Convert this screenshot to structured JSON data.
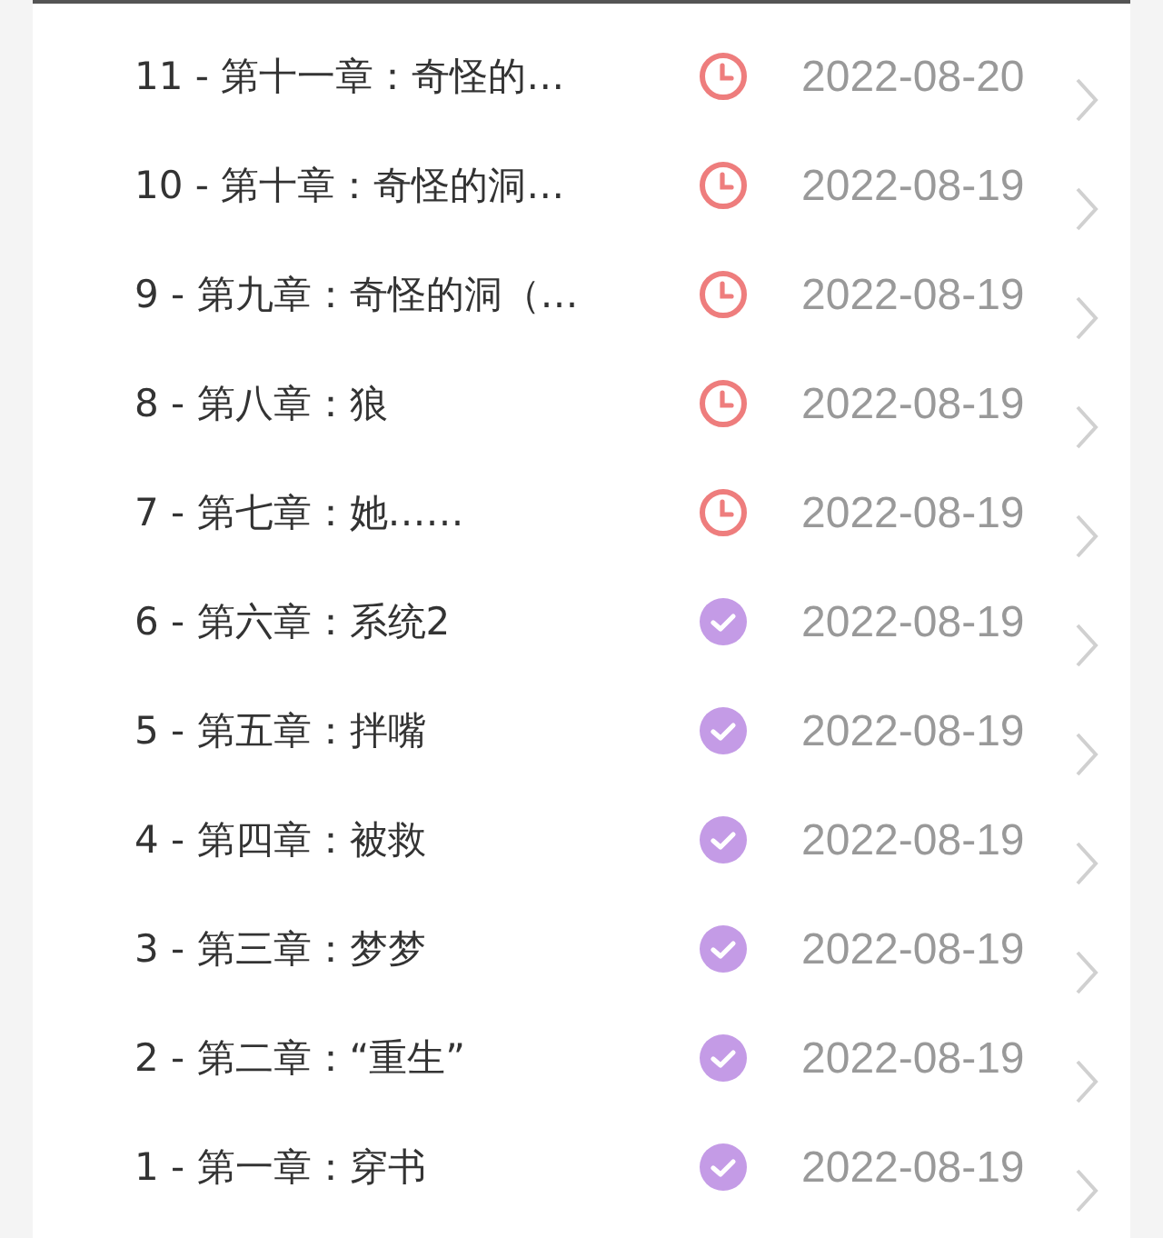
{
  "chapters": [
    {
      "title": "11 - 第十一章：奇怪的…",
      "done": false,
      "date": "2022-08-20"
    },
    {
      "title": "10 - 第十章：奇怪的洞…",
      "done": false,
      "date": "2022-08-19"
    },
    {
      "title": "9 - 第九章：奇怪的洞（…",
      "done": false,
      "date": "2022-08-19"
    },
    {
      "title": "8 - 第八章：狼",
      "done": false,
      "date": "2022-08-19"
    },
    {
      "title": "7 - 第七章：她……",
      "done": false,
      "date": "2022-08-19"
    },
    {
      "title": "6 - 第六章：系统2",
      "done": true,
      "date": "2022-08-19"
    },
    {
      "title": "5 - 第五章：拌嘴",
      "done": true,
      "date": "2022-08-19"
    },
    {
      "title": "4 - 第四章：被救",
      "done": true,
      "date": "2022-08-19"
    },
    {
      "title": "3 - 第三章：梦梦",
      "done": true,
      "date": "2022-08-19"
    },
    {
      "title": "2 - 第二章：“重生”",
      "done": true,
      "date": "2022-08-19"
    },
    {
      "title": "1 - 第一章：穿书",
      "done": true,
      "date": "2022-08-19"
    }
  ]
}
